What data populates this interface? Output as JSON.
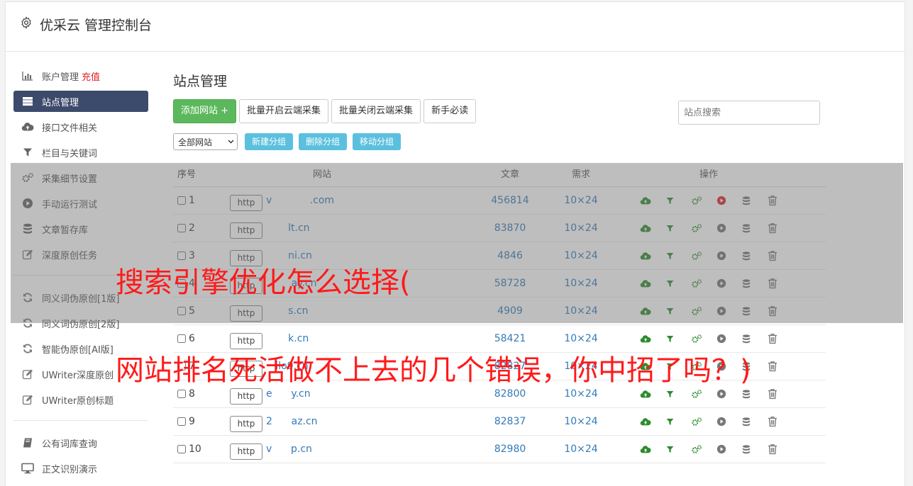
{
  "app": {
    "title": "优采云 管理控制台"
  },
  "sidebar": {
    "items": [
      {
        "label": "账户管理",
        "extra": "充值",
        "icon": "bar-chart-icon"
      },
      {
        "label": "站点管理",
        "icon": "server-icon",
        "active": true
      },
      {
        "label": "接口文件相关",
        "icon": "cloud-upload-icon"
      },
      {
        "label": "栏目与关键词",
        "icon": "filter-icon"
      },
      {
        "label": "采集细节设置",
        "icon": "cogs-icon"
      },
      {
        "label": "手动运行测试",
        "icon": "play-icon"
      },
      {
        "label": "文章暂存库",
        "icon": "database-icon"
      },
      {
        "label": "深度原创任务",
        "icon": "edit-icon"
      }
    ],
    "items2": [
      {
        "label": "同义词伪原创[1版]",
        "icon": "refresh-icon"
      },
      {
        "label": "同义词伪原创[2版]",
        "icon": "refresh-icon"
      },
      {
        "label": "智能伪原创[AI版]",
        "icon": "refresh-icon"
      },
      {
        "label": "UWriter深度原创",
        "icon": "edit-icon"
      },
      {
        "label": "UWriter原创标题",
        "icon": "edit-icon"
      }
    ],
    "items3": [
      {
        "label": "公有词库查询",
        "icon": "book-icon"
      },
      {
        "label": "正文识别演示",
        "icon": "monitor-icon"
      }
    ]
  },
  "main": {
    "title": "站点管理",
    "add_site": "添加网站 +",
    "batch_on": "批量开启云端采集",
    "batch_off": "批量关闭云端采集",
    "newbie": "新手必读",
    "search_placeholder": "站点搜索",
    "group_select": "全部网站",
    "new_group": "新建分组",
    "delete_group": "删除分组",
    "move_group": "移动分组"
  },
  "table": {
    "headers": {
      "index": "序号",
      "site": "网站",
      "articles": "文章",
      "demand": "需求",
      "ops": "操作"
    },
    "rows": [
      {
        "index": "1",
        "protocol": "http",
        "site": "v            .com",
        "articles": "456814",
        "demand": "10×24",
        "run_active": true
      },
      {
        "index": "2",
        "protocol": "http",
        "site": "       lt.cn",
        "articles": "83870",
        "demand": "10×24",
        "run_active": false
      },
      {
        "index": "3",
        "protocol": "http",
        "site": "       ni.cn",
        "articles": "4846",
        "demand": "10×24",
        "run_active": false
      },
      {
        "index": "4",
        "protocol": "http",
        "site": "        ay.cn",
        "articles": "58728",
        "demand": "10×24",
        "run_active": false
      },
      {
        "index": "5",
        "protocol": "http",
        "site": "       s.cn",
        "articles": "4909",
        "demand": "10×24",
        "run_active": false
      },
      {
        "index": "6",
        "protocol": "http",
        "site": "       k.cn",
        "articles": "58421",
        "demand": "10×24",
        "run_active": false
      },
      {
        "index": "7",
        "protocol": "http",
        "site": "   ilo9.cn",
        "articles": "82827",
        "demand": "10×24",
        "run_active": false
      },
      {
        "index": "8",
        "protocol": "http",
        "site": "e      y.cn",
        "articles": "82800",
        "demand": "10×24",
        "run_active": false
      },
      {
        "index": "9",
        "protocol": "http",
        "site": "2      az.cn",
        "articles": "82837",
        "demand": "10×24",
        "run_active": false
      },
      {
        "index": "10",
        "protocol": "http",
        "site": "v      p.cn",
        "articles": "82980",
        "demand": "10×24",
        "run_active": false
      }
    ]
  },
  "watermark": {
    "line1": "搜索引擎优化怎么选择(",
    "line2": "网站排名死活做不上去的几个错误，你中招了吗？)"
  },
  "colors": {
    "sidebar_active": "#3c4a6b",
    "green_button": "#5cb85c",
    "blue_button": "#5bc0de",
    "link": "#337ab7",
    "watermark": "#ff1a1a",
    "run_active": "#e0262d",
    "icon_green": "#2e8b2e"
  }
}
